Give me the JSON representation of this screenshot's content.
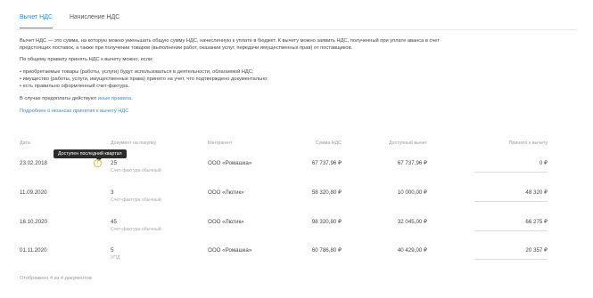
{
  "tabs": [
    "Вычет НДС",
    "Начисление НДС"
  ],
  "paragraphs": {
    "p1_line1": "Вычет НДС — это сумма, на которую можно уменьшать общую сумму НДС, начисленную к уплате в бюджет. К вычету можно заявить НДС, полученный при уплате аванса в счет",
    "p1_line2": "предстоящих поставок, а также при получении товаров (выполнении работ, оказании услуг, передачи имущественных прав) от поставщиков.",
    "p2": "По общему правилу принять НДС к вычету можно, если:",
    "bullet1": "• приобретаемые товары (работы, услуги) будут использоваться в деятельности, облагаемой НДС;",
    "bullet2": "• имущество (работы, услуги, имущественные права) принято на учет, что подтверждено документально;",
    "bullet3": "• есть правильно оформленный счет-фактура.",
    "p3_prefix": "В случае предоплаты действуют ",
    "p3_link": "иные правила",
    "p3_suffix": ".",
    "more_link": "Подробнее о нюансах принятия к вычету НДС"
  },
  "table": {
    "headers": {
      "date": "Дата",
      "document": "Документ на покупку",
      "counterparty": "Контрагент",
      "vat_sum": "Сумма НДС",
      "available": "Доступный вычет",
      "accepted": "Принято к вычету"
    },
    "tooltip": "Доступен последний квартал",
    "rows": [
      {
        "date": "23.02.2018",
        "doc_no": "25",
        "doc_type": "Счет-фактура обычный",
        "counterparty": "ООО «Ромашка»",
        "vat": "67 737,96 ₽",
        "available": "67 737,96 ₽",
        "accepted": "0 ₽"
      },
      {
        "date": "11.09.2020",
        "doc_no": "3",
        "doc_type": "Счет-фактура обычный",
        "counterparty": "ООО «Лютик»",
        "vat": "58 320,80 ₽",
        "available": "10 000,00 ₽",
        "accepted": "48 320 ₽"
      },
      {
        "date": "16.10.2020",
        "doc_no": "45",
        "doc_type": "Счет-фактура обычный",
        "counterparty": "ООО «Лютик»",
        "vat": "98 320,80 ₽",
        "available": "32 045,00 ₽",
        "accepted": "66 275 ₽"
      },
      {
        "date": "01.11.2020",
        "doc_no": "5",
        "doc_type": "УПД",
        "counterparty": "ООО «Ромашка»",
        "vat": "60 786,80 ₽",
        "available": "40 429,00 ₽",
        "accepted": "20 357 ₽"
      }
    ]
  },
  "footer": "Отображено 4 из 4 документов",
  "colors": {
    "accent": "#2f8fd8",
    "warning": "#f2b134"
  }
}
